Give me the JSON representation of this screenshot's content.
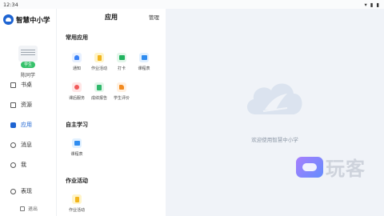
{
  "status": {
    "time": "12:34",
    "icons": "▾ ▮ ▮"
  },
  "brand": {
    "name": "智慧中小学"
  },
  "profile": {
    "role_badge": "学生",
    "username": "陈同学"
  },
  "nav": {
    "items": [
      {
        "label": "书桌"
      },
      {
        "label": "资源"
      },
      {
        "label": "应用"
      },
      {
        "label": "消息"
      },
      {
        "label": "我"
      },
      {
        "label": "表现"
      }
    ],
    "logout_label": "退出"
  },
  "panel": {
    "title": "应用",
    "manage_label": "管理",
    "sections": [
      {
        "title": "常用应用",
        "apps": [
          {
            "label": "通知",
            "icon": "bell-icon",
            "color": "#3a82f7"
          },
          {
            "label": "作业活动",
            "icon": "homework-icon",
            "color": "#f2b51d"
          },
          {
            "label": "打卡",
            "icon": "check-in-icon",
            "color": "#21b35f"
          },
          {
            "label": "课程表",
            "icon": "timetable-icon",
            "color": "#2f8cf0"
          },
          {
            "label": "课后服务",
            "icon": "heart-service-icon",
            "color": "#f15a5a"
          },
          {
            "label": "成绩报告",
            "icon": "report-icon",
            "color": "#2fb86b"
          },
          {
            "label": "学生评价",
            "icon": "thumbs-up-icon",
            "color": "#f28a1f"
          }
        ]
      },
      {
        "title": "自主学习",
        "apps": [
          {
            "label": "课程表",
            "icon": "timetable-icon",
            "color": "#2f8cf0"
          }
        ]
      },
      {
        "title": "作业活动",
        "apps": [
          {
            "label": "作业活动",
            "icon": "homework-icon",
            "color": "#f2b51d"
          }
        ]
      }
    ]
  },
  "right": {
    "welcome": "欢迎使用智慧中小学",
    "watermark_text": "玩客"
  }
}
